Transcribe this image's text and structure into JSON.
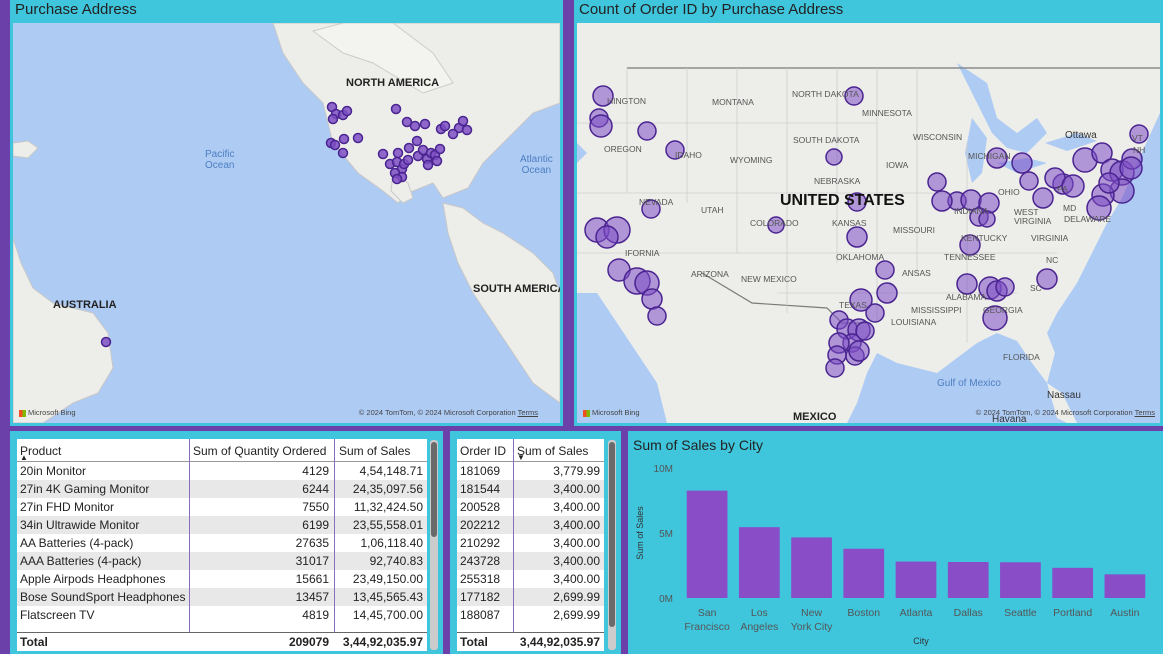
{
  "left_map": {
    "title": "Purchase Address",
    "labels": {
      "north_america": "NORTH AMERICA",
      "pacific": "Pacific",
      "pacific2": "Ocean",
      "atlantic": "Atlantic",
      "atlantic2": "Ocean",
      "australia": "AUSTRALIA",
      "south_america": "SOUTH AMERICA"
    },
    "bing": "Microsoft Bing",
    "attribution": "© 2024 TomTom, © 2024 Microsoft Corporation",
    "terms": "Terms"
  },
  "right_map": {
    "title": "Count of Order ID by Purchase Address",
    "labels": {
      "usa": "UNITED STATES",
      "mexico": "MEXICO",
      "gulf": "Gulf of Mexico",
      "nassau": "Nassau",
      "havana": "Havana",
      "ottawa": "Ottawa",
      "washington": "HINGTON",
      "oregon": "OREGON",
      "idaho": "IDAHO",
      "montana": "MONTANA",
      "wyoming": "WYOMING",
      "nevada": "NEVADA",
      "utah": "UTAH",
      "colorado": "COLORADO",
      "arizona": "ARIZONA",
      "new_mexico": "NEW MEXICO",
      "california": "IFORNIA",
      "north_dakota": "NORTH DAKOTA",
      "south_dakota": "SOUTH DAKOTA",
      "nebraska": "NEBRASKA",
      "kansas": "KANSAS",
      "oklahoma": "OKLAHOMA",
      "texas": "TEXAS",
      "minnesota": "MINNESOTA",
      "iowa": "IOWA",
      "missouri": "MISSOURI",
      "arkansas": "ANSAS",
      "louisiana": "LOUISIANA",
      "wisconsin": "WISCONSIN",
      "michigan": "MICHIGAN",
      "ohio": "OHIO",
      "indiana": "INDIANA",
      "kentucky": "KENTUCKY",
      "tennessee": "TENNESSEE",
      "mississippi": "MISSISSIPPI",
      "alabama": "ALABAMA",
      "georgia": "GEORGIA",
      "florida": "FLORIDA",
      "sc": "SC",
      "nc": "NC",
      "virginia": "VIRGINIA",
      "west_virginia": "WEST",
      "west_virginia2": "VIRGINIA",
      "pa": "PA",
      "md": "MD",
      "delaware": "DELAWARE",
      "vt": "VT",
      "nh": "NH"
    },
    "bing": "Microsoft Bing",
    "attribution": "© 2024 TomTom, © 2024 Microsoft Corporation",
    "terms": "Terms"
  },
  "product_table": {
    "headers": [
      "Product",
      "Sum of Quantity Ordered",
      "Sum of Sales"
    ],
    "rows": [
      [
        "20in Monitor",
        "4129",
        "4,54,148.71"
      ],
      [
        "27in 4K Gaming Monitor",
        "6244",
        "24,35,097.56"
      ],
      [
        "27in FHD Monitor",
        "7550",
        "11,32,424.50"
      ],
      [
        "34in Ultrawide Monitor",
        "6199",
        "23,55,558.01"
      ],
      [
        "AA Batteries (4-pack)",
        "27635",
        "1,06,118.40"
      ],
      [
        "AAA Batteries (4-pack)",
        "31017",
        "92,740.83"
      ],
      [
        "Apple Airpods Headphones",
        "15661",
        "23,49,150.00"
      ],
      [
        "Bose SoundSport Headphones",
        "13457",
        "13,45,565.43"
      ],
      [
        "Flatscreen TV",
        "4819",
        "14,45,700.00"
      ]
    ],
    "total": [
      "Total",
      "209079",
      "3,44,92,035.97"
    ]
  },
  "order_table": {
    "headers": [
      "Order ID",
      "Sum of Sales"
    ],
    "rows": [
      [
        "181069",
        "3,779.99"
      ],
      [
        "181544",
        "3,400.00"
      ],
      [
        "200528",
        "3,400.00"
      ],
      [
        "202212",
        "3,400.00"
      ],
      [
        "210292",
        "3,400.00"
      ],
      [
        "243728",
        "3,400.00"
      ],
      [
        "255318",
        "3,400.00"
      ],
      [
        "177182",
        "2,699.99"
      ],
      [
        "188087",
        "2,699.99"
      ]
    ],
    "total": [
      "Total",
      "3,44,92,035.97"
    ]
  },
  "chart_data": {
    "type": "bar",
    "title": "Sum of Sales by City",
    "xlabel": "City",
    "ylabel": "Sum of Sales",
    "categories": [
      "San Francisco",
      "Los Angeles",
      "New York City",
      "Boston",
      "Atlanta",
      "Dallas",
      "Seattle",
      "Portland",
      "Austin"
    ],
    "category_lines": [
      [
        "San",
        "Francisco"
      ],
      [
        "Los",
        "Angeles"
      ],
      [
        "New",
        "York City"
      ],
      [
        "Boston"
      ],
      [
        "Atlanta"
      ],
      [
        "Dallas"
      ],
      [
        "Seattle"
      ],
      [
        "Portland"
      ],
      [
        "Austin"
      ]
    ],
    "values": [
      8260000,
      5450000,
      4660000,
      3790000,
      2800000,
      2770000,
      2750000,
      2320000,
      1820000
    ],
    "yticks": [
      {
        "v": 0,
        "label": "0M"
      },
      {
        "v": 5000000,
        "label": "5M"
      },
      {
        "v": 10000000,
        "label": "10M"
      }
    ],
    "ylim": [
      0,
      10000000
    ],
    "color": "#8a4dc8",
    "grid": false
  },
  "colors": {
    "background": "#6b40a8",
    "panel": "#3fc6dd",
    "bubble": "#7e4fc4",
    "bubble_edge": "#4a2490"
  }
}
